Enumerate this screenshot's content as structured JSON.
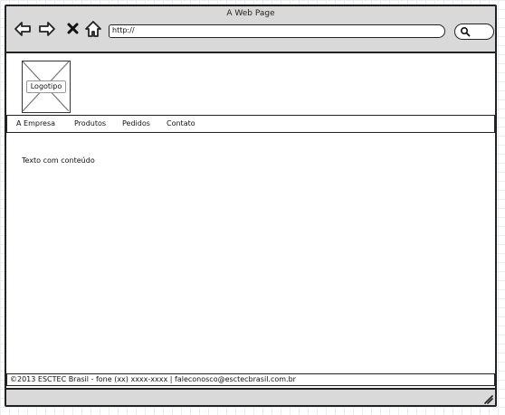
{
  "window": {
    "title": "A Web Page",
    "url": "http://"
  },
  "icons": {
    "back": "back-arrow-icon",
    "forward": "forward-arrow-icon",
    "stop": "close-icon",
    "home": "home-icon",
    "search": "search-icon"
  },
  "logo": {
    "label": "Logotipo"
  },
  "menu": {
    "items": [
      {
        "label": "A Empresa"
      },
      {
        "label": "Produtos"
      },
      {
        "label": "Pedidos"
      },
      {
        "label": "Contato"
      }
    ]
  },
  "content": {
    "text": "Texto com conteúdo"
  },
  "footer": {
    "text": "©2013  ESCTEC Brasil - fone (xx) xxxx-xxxx | faleconosco@esctecbrasil.com.br"
  },
  "colors": {
    "chrome": "#d9d9d9",
    "border": "#222222",
    "grid": "#e9eef3"
  }
}
